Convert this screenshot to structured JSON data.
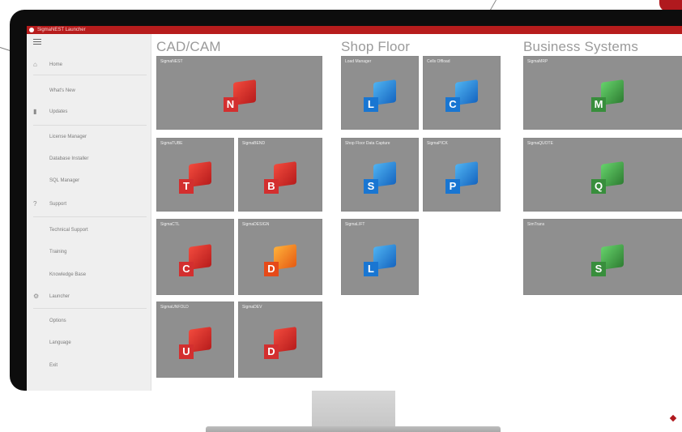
{
  "app": {
    "title": "SigmaNEST Launcher"
  },
  "sidebar": {
    "items": [
      {
        "label": "Home",
        "icon": "home-icon"
      },
      {
        "label": "What's New",
        "icon": ""
      },
      {
        "label": "Updates",
        "icon": "updates-icon"
      },
      {
        "label": "License Manager",
        "icon": ""
      },
      {
        "label": "Database Installer",
        "icon": ""
      },
      {
        "label": "SQL Manager",
        "icon": ""
      },
      {
        "label": "Support",
        "icon": "question-icon"
      },
      {
        "label": "Technical Support",
        "icon": ""
      },
      {
        "label": "Training",
        "icon": ""
      },
      {
        "label": "Knowledge Base",
        "icon": ""
      },
      {
        "label": "Launcher",
        "icon": "gear-icon"
      },
      {
        "label": "Options",
        "icon": ""
      },
      {
        "label": "Language",
        "icon": ""
      },
      {
        "label": "Exit",
        "icon": ""
      }
    ]
  },
  "sections": {
    "cadcam": {
      "title": "CAD/CAM",
      "tiles": [
        {
          "label": "SigmaNEST",
          "letter": "N",
          "color": "red"
        },
        {
          "label": "SigmaTUBE",
          "letter": "T",
          "color": "red"
        },
        {
          "label": "SigmaBEND",
          "letter": "B",
          "color": "red"
        },
        {
          "label": "SigmaCTL",
          "letter": "C",
          "color": "red"
        },
        {
          "label": "SigmaDESIGN",
          "letter": "D",
          "color": "orange"
        },
        {
          "label": "SigmaUNFOLD",
          "letter": "U",
          "color": "red"
        },
        {
          "label": "SigmaDEV",
          "letter": "D",
          "color": "red"
        }
      ]
    },
    "shopfloor": {
      "title": "Shop Floor",
      "tiles": [
        {
          "label": "Load Manager",
          "letter": "L",
          "color": "blue"
        },
        {
          "label": "Cells Offload",
          "letter": "C",
          "color": "blue"
        },
        {
          "label": "Shop Floor Data Capture",
          "letter": "S",
          "color": "blue"
        },
        {
          "label": "SigmaPICK",
          "letter": "P",
          "color": "blue"
        },
        {
          "label": "SigmaLIFT",
          "letter": "L",
          "color": "blue"
        }
      ]
    },
    "business": {
      "title": "Business Systems",
      "tiles": [
        {
          "label": "SigmaMRP",
          "letter": "M",
          "color": "green"
        },
        {
          "label": "SigmaQUOTE",
          "letter": "Q",
          "color": "green"
        },
        {
          "label": "SimTrans",
          "letter": "S",
          "color": "green"
        }
      ]
    }
  }
}
